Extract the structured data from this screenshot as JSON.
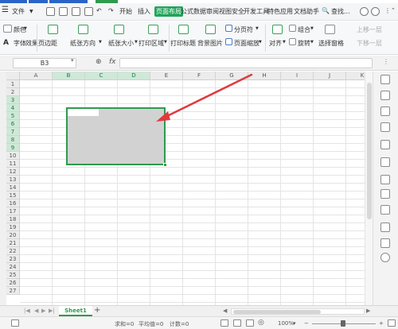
{
  "menubar": {
    "items": [
      "文件",
      "开始",
      "插入",
      "页面布局",
      "公式",
      "数据",
      "审阅",
      "视图",
      "安全",
      "开发工具",
      "特色应用",
      "文档助手"
    ],
    "search_label": "查找..."
  },
  "ribbon": {
    "color_label": "颜色",
    "font_label": "字体",
    "effect_label": "效果",
    "margin_label": "页边距",
    "orientation_label": "纸张方向",
    "size_label": "纸张大小",
    "print_area_label": "打印区域",
    "print_title_label": "打印标题",
    "bg_image_label": "背景图片",
    "page_break_label": "分页符",
    "page_zoom_label": "页面缩放",
    "align_label": "对齐",
    "group_label": "组合",
    "rotate_label": "旋转",
    "select_pane_label": "选择窗格",
    "move_up_label": "上移一层",
    "move_down_label": "下移一层"
  },
  "formula_bar": {
    "cell_ref": "B3",
    "fx_label": "fx",
    "value": ""
  },
  "grid": {
    "columns": [
      "A",
      "B",
      "C",
      "D",
      "E",
      "F",
      "G",
      "H",
      "I",
      "J",
      "K"
    ],
    "selected_columns": [
      "B",
      "C",
      "D"
    ],
    "rows": [
      "1",
      "2",
      "3",
      "4",
      "5",
      "6",
      "7",
      "8",
      "9",
      "10",
      "11",
      "12",
      "13",
      "14",
      "15",
      "16",
      "17",
      "18",
      "19",
      "20",
      "21",
      "22",
      "23",
      "24",
      "25",
      "26",
      "27"
    ],
    "selected_rows": [
      "3",
      "4",
      "5",
      "6",
      "7",
      "8",
      "9"
    ],
    "selection_range": "B3:D9"
  },
  "sheet_tabs": {
    "active": "Sheet1",
    "add_label": "+"
  },
  "status_bar": {
    "sum": "求和=0",
    "average": "平均值=0",
    "count": "计数=0",
    "zoom": "100%",
    "zoom_minus": "−",
    "zoom_plus": "+"
  },
  "colors": {
    "accent": "#2f9a4e",
    "arrow": "#e03a3e",
    "selection_fill": "#d2d2d2"
  }
}
